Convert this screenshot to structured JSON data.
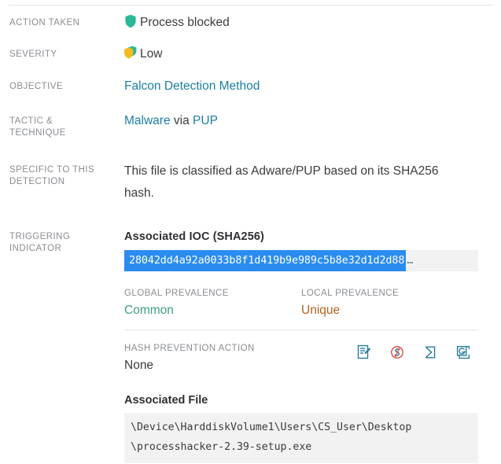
{
  "detail_rows": [
    {
      "id": "action-taken",
      "label": "ACTION TAKEN",
      "value": "Process blocked",
      "icon": "shield-green-icon"
    },
    {
      "id": "severity",
      "label": "SEVERITY",
      "value": "Low",
      "icon": "shield-low-severity-icon"
    },
    {
      "id": "objective",
      "label": "OBJECTIVE",
      "value": "Falcon Detection Method"
    },
    {
      "id": "tactic-technique",
      "label": "TACTIC & TECHNIQUE",
      "label_line1": "TACTIC &",
      "label_line2": "TECHNIQUE",
      "tactic": "Malware",
      "connector": "via",
      "technique": "PUP"
    },
    {
      "id": "specific-to-this-detection",
      "label": "SPECIFIC TO THIS DETECTION",
      "label_line1": "SPECIFIC TO THIS",
      "label_line2": "DETECTION",
      "value": "This file is classified as Adware/PUP based on its SHA256 hash."
    },
    {
      "id": "triggering-indicator",
      "label": "TRIGGERING INDICATOR",
      "label_line1": "TRIGGERING",
      "label_line2": "INDICATOR"
    }
  ],
  "triggering_indicator": {
    "ioc_heading": "Associated IOC (SHA256)",
    "ioc_hash": "28042dd4a92a0033b8f1d419b9e989c5b8e32d1d2d88",
    "ioc_truncation": "…",
    "prevalence": [
      {
        "id": "global-prevalence",
        "label": "GLOBAL PREVALENCE",
        "value": "Common",
        "color": "#3f9c86"
      },
      {
        "id": "local-prevalence",
        "label": "LOCAL PREVALENCE",
        "value": "Unique",
        "color": "#b3621b"
      }
    ],
    "hash_prevention": {
      "label": "HASH PREVENTION ACTION",
      "value": "None"
    },
    "action_icons": [
      {
        "id": "edit-document-icon",
        "title": "Edit"
      },
      {
        "id": "virustotal-icon",
        "title": "VirusTotal"
      },
      {
        "id": "sigma-query-icon",
        "title": "Query"
      },
      {
        "id": "external-search-icon",
        "title": "Search"
      }
    ],
    "file_heading": "Associated File",
    "file_path_line1": "\\Device\\HarddiskVolume1\\Users\\CS_User\\Desktop",
    "file_path_line2": "\\processhacker-2.39-setup.exe"
  },
  "colors": {
    "link": "#1a7fa3",
    "label": "#8a8d91",
    "text": "#3c3c3c",
    "selection": "#2a8cf0",
    "field_bg": "#f2f2f2",
    "shield_green": "#2cb896",
    "shield_yellow": "#f5bb1d"
  }
}
